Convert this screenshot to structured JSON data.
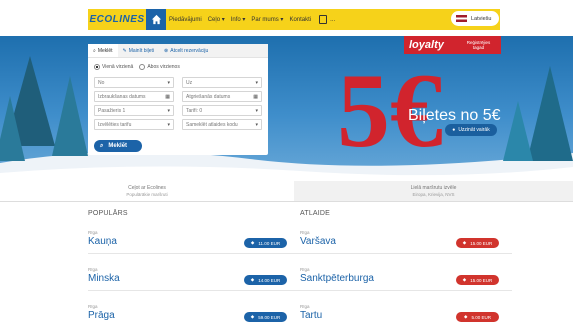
{
  "nav": {
    "logo": "ECOLINES",
    "items": [
      "Piedāvājumi",
      "Ceļo",
      "Info",
      "Par mums",
      "Kontakti"
    ],
    "doc_label": "...",
    "lang": "Latviešu",
    "brand_color": "#f6d21a",
    "accent_color": "#1c63a8"
  },
  "hero": {
    "loyalty_title": "loyalty",
    "loyalty_sub": "Reģistrējies tagad",
    "big_price": "5€",
    "promo_text": "Biļetes no 5€",
    "promo_button": "Uzzināt vairāk",
    "promo_color": "#d1242d"
  },
  "form": {
    "tabs": [
      "Meklēt",
      "Mainīt biļeti",
      "Atcelt rezervāciju"
    ],
    "radio_one_way": "Vienā virzienā",
    "radio_return": "Abos virzienos",
    "from_placeholder": "No",
    "to_placeholder": "Uz",
    "depart_placeholder": "Izbraukšanas datums",
    "return_placeholder": "Atgriešanās datums",
    "passengers": "Pasažieris 1",
    "currency": "Tarifi: 0",
    "discount": "Izvēlēties tarifu",
    "promo_code": "Sameklēt atlaides kodu",
    "search_label": "Meklēt"
  },
  "tabs2": [
    {
      "title": "Ceļot ar Ecolines",
      "sub": "Populārākie maršruti"
    },
    {
      "title": "Lielā maršrutu izvēle",
      "sub": "Eiropa, Krievija, NVS"
    }
  ],
  "popular": {
    "title": "POPULĀRS",
    "routes": [
      {
        "from": "Rīga",
        "to": "Kauņa",
        "price": "11.00 EUR"
      },
      {
        "from": "Rīga",
        "to": "Minska",
        "price": "14.00 EUR"
      },
      {
        "from": "Rīga",
        "to": "Prāga",
        "price": "59.00 EUR"
      }
    ]
  },
  "discounts": {
    "title": "ATLAIDE",
    "routes": [
      {
        "from": "Rīga",
        "to": "Varšava",
        "price": "15.00 EUR"
      },
      {
        "from": "Rīga",
        "to": "Sanktpēterburga",
        "price": "15.00 EUR"
      },
      {
        "from": "Rīga",
        "to": "Tartu",
        "price": "5.00 EUR"
      }
    ]
  }
}
